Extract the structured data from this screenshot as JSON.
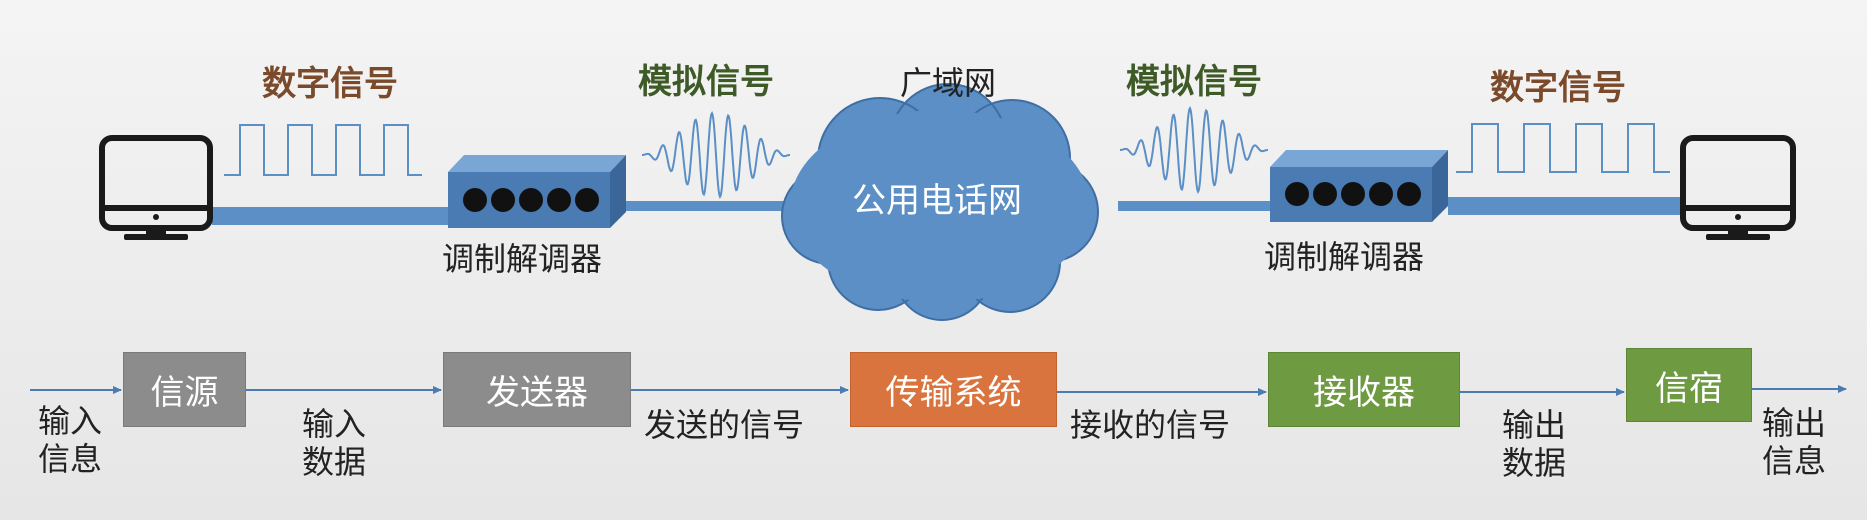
{
  "top": {
    "left_digital_label": "数字信号",
    "left_analog_label": "模拟信号",
    "wan_label": "广域网",
    "cloud_label": "公用电话网",
    "right_analog_label": "模拟信号",
    "right_digital_label": "数字信号",
    "left_modem_label": "调制解调器",
    "right_modem_label": "调制解调器"
  },
  "flow": {
    "blocks": [
      {
        "label": "信源",
        "color": "#8c8c8c"
      },
      {
        "label": "发送器",
        "color": "#8c8c8c"
      },
      {
        "label": "传输系统",
        "color": "#d9743e"
      },
      {
        "label": "接收器",
        "color": "#6e9a42"
      },
      {
        "label": "信宿",
        "color": "#6e9a42"
      }
    ],
    "input_info": "输入\n信息",
    "input_data": "输入\n数据",
    "sent_signal": "发送的信号",
    "received_signal": "接收的信号",
    "output_data": "输出\n数据",
    "output_info": "输出\n信息"
  },
  "colors": {
    "cable": "#5b8fc6",
    "modem": "#4a7bb3",
    "cloud": "#5b8fc6",
    "arrow": "#4a7bb3",
    "monitor": "#1a1a1a"
  }
}
